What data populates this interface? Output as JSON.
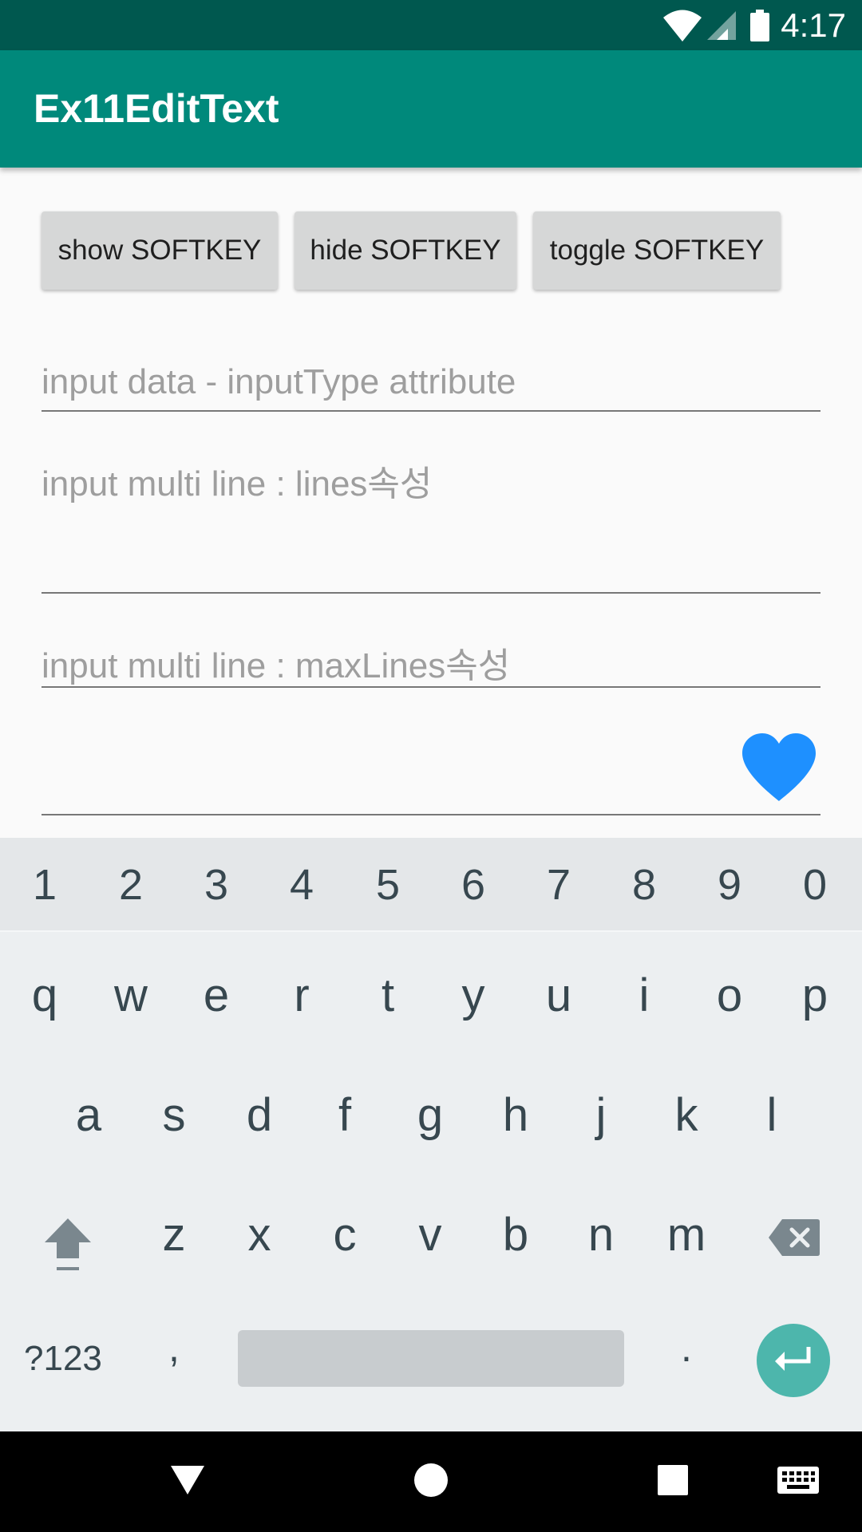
{
  "status_bar": {
    "time": "4:17"
  },
  "app_bar": {
    "title": "Ex11EditText"
  },
  "buttons": {
    "show": "show SOFTKEY",
    "hide": "hide SOFTKEY",
    "toggle": "toggle SOFTKEY"
  },
  "fields": {
    "input_type_hint": "input data - inputType attribute",
    "lines_hint": "input multi line : lines속성",
    "max_lines_hint": "input multi line : maxLines속성"
  },
  "colors": {
    "status_bar": "#00584f",
    "app_bar": "#00897b",
    "heart": "#1e90ff",
    "enter_key": "#4db6ac"
  },
  "keyboard": {
    "number_row": [
      "1",
      "2",
      "3",
      "4",
      "5",
      "6",
      "7",
      "8",
      "9",
      "0"
    ],
    "row1": [
      "q",
      "w",
      "e",
      "r",
      "t",
      "y",
      "u",
      "i",
      "o",
      "p"
    ],
    "row2": [
      "a",
      "s",
      "d",
      "f",
      "g",
      "h",
      "j",
      "k",
      "l"
    ],
    "row3": [
      "z",
      "x",
      "c",
      "v",
      "b",
      "n",
      "m"
    ],
    "symbols_key": "?123",
    "comma_key": ",",
    "period_key": "."
  },
  "icons": {
    "status": [
      "wifi-icon",
      "signal-icon",
      "battery-icon"
    ],
    "field": "heart-icon",
    "keyboard": [
      "shift-icon",
      "backspace-icon",
      "enter-icon"
    ],
    "nav": [
      "back-icon",
      "home-icon",
      "recents-icon",
      "keyboard-icon"
    ]
  }
}
